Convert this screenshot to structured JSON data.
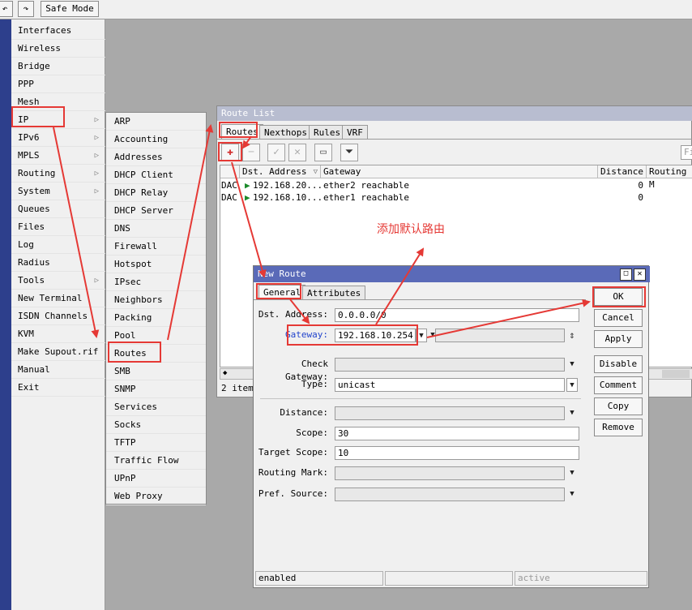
{
  "toolbar": {
    "undo_icon": "undo-icon",
    "redo_icon": "redo-icon",
    "safe_mode": "Safe Mode"
  },
  "main_menu": [
    {
      "label": "Interfaces",
      "arrow": ""
    },
    {
      "label": "Wireless",
      "arrow": ""
    },
    {
      "label": "Bridge",
      "arrow": ""
    },
    {
      "label": "PPP",
      "arrow": ""
    },
    {
      "label": "Mesh",
      "arrow": ""
    },
    {
      "label": "IP",
      "arrow": "▷"
    },
    {
      "label": "IPv6",
      "arrow": "▷"
    },
    {
      "label": "MPLS",
      "arrow": "▷"
    },
    {
      "label": "Routing",
      "arrow": "▷"
    },
    {
      "label": "System",
      "arrow": "▷"
    },
    {
      "label": "Queues",
      "arrow": ""
    },
    {
      "label": "Files",
      "arrow": ""
    },
    {
      "label": "Log",
      "arrow": ""
    },
    {
      "label": "Radius",
      "arrow": ""
    },
    {
      "label": "Tools",
      "arrow": "▷"
    },
    {
      "label": "New Terminal",
      "arrow": ""
    },
    {
      "label": "ISDN Channels",
      "arrow": ""
    },
    {
      "label": "KVM",
      "arrow": ""
    },
    {
      "label": "Make Supout.rif",
      "arrow": ""
    },
    {
      "label": "Manual",
      "arrow": ""
    },
    {
      "label": "Exit",
      "arrow": ""
    }
  ],
  "ip_submenu": [
    "ARP",
    "Accounting",
    "Addresses",
    "DHCP Client",
    "DHCP Relay",
    "DHCP Server",
    "DNS",
    "Firewall",
    "Hotspot",
    "IPsec",
    "Neighbors",
    "Packing",
    "Pool",
    "Routes",
    "SMB",
    "SNMP",
    "Services",
    "Socks",
    "TFTP",
    "Traffic Flow",
    "UPnP",
    "Web Proxy"
  ],
  "route_list": {
    "title": "Route List",
    "tabs": [
      "Routes",
      "Nexthops",
      "Rules",
      "VRF"
    ],
    "find_placeholder": "Fi",
    "columns": [
      "Dst. Address",
      "Gateway",
      "Distance",
      "Routing M"
    ],
    "rows": [
      {
        "flags": "DAC",
        "dst": "192.168.20...",
        "gateway": "ether2 reachable",
        "distance": "0"
      },
      {
        "flags": "DAC",
        "dst": "192.168.10...",
        "gateway": "ether1 reachable",
        "distance": "0"
      }
    ],
    "status": "2 items"
  },
  "new_route": {
    "title": "New Route",
    "tabs": [
      "General",
      "Attributes"
    ],
    "fields": {
      "dst_label": "Dst. Address:",
      "dst_value": "0.0.0.0/0",
      "gw_label": "Gateway:",
      "gw_value": "192.168.10.254",
      "check_label": "Check Gateway:",
      "check_value": "",
      "type_label": "Type:",
      "type_value": "unicast",
      "dist_label": "Distance:",
      "dist_value": "",
      "scope_label": "Scope:",
      "scope_value": "30",
      "tscope_label": "Target Scope:",
      "tscope_value": "10",
      "rmark_label": "Routing Mark:",
      "rmark_value": "",
      "psrc_label": "Pref. Source:",
      "psrc_value": ""
    },
    "buttons": [
      "OK",
      "Cancel",
      "Apply",
      "Disable",
      "Comment",
      "Copy",
      "Remove"
    ],
    "status_left": "enabled",
    "status_right": "active"
  },
  "annotation": {
    "note": "添加默认路由",
    "color": "#e53935"
  }
}
